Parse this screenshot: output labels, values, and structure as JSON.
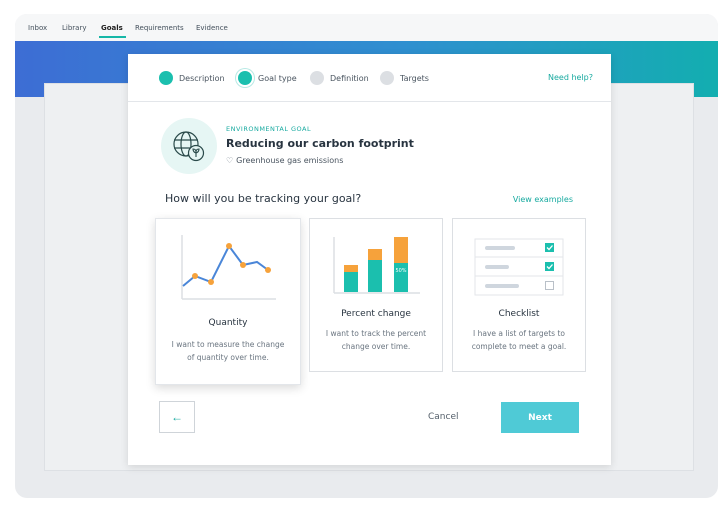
{
  "topnav": {
    "items": [
      {
        "label": "Inbox"
      },
      {
        "label": "Library"
      },
      {
        "label": "Goals"
      },
      {
        "label": "Requirements"
      },
      {
        "label": "Evidence"
      }
    ]
  },
  "steps": {
    "items": [
      {
        "label": "Description",
        "state": "done"
      },
      {
        "label": "Goal type",
        "state": "current"
      },
      {
        "label": "Definition",
        "state": "pending"
      },
      {
        "label": "Targets",
        "state": "pending"
      }
    ],
    "help_label": "Need help?"
  },
  "goal": {
    "kicker": "ENVIRONMENTAL GOAL",
    "title": "Reducing our carbon footprint",
    "subtitle": "Greenhouse gas emissions",
    "icon": "globe-leaf-icon"
  },
  "question": {
    "text": "How will you be tracking your goal?",
    "examples_label": "View examples"
  },
  "cards": [
    {
      "title": "Quantity",
      "desc": "I want to measure the change of quantity over time.",
      "selected": true
    },
    {
      "title": "Percent change",
      "desc": "I want to track the percent change over time.",
      "selected": false,
      "badge": "50%"
    },
    {
      "title": "Checklist",
      "desc": "I have a list of targets to complete to meet a goal.",
      "selected": false
    }
  ],
  "actions": {
    "back_icon": "←",
    "cancel_label": "Cancel",
    "next_label": "Next"
  },
  "colors": {
    "accent": "#1bbfae",
    "orange": "#f6a23b",
    "blue_line": "#4a86d8",
    "next_button": "#4fcad6"
  }
}
